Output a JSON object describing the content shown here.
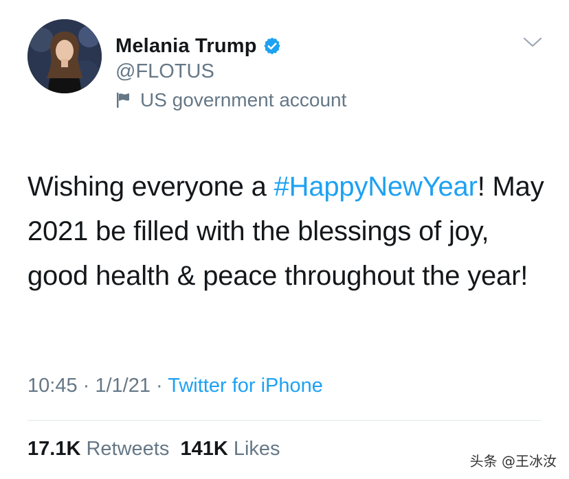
{
  "user": {
    "display_name": "Melania Trump",
    "handle": "@FLOTUS",
    "label": "US government account",
    "verified_icon": "verified-badge-icon",
    "label_icon": "flag-icon"
  },
  "tweet": {
    "text_prefix": "Wishing everyone a ",
    "hashtag": "#HappyNewYear",
    "text_suffix": "! May 2021 be filled with the blessings of joy, good health & peace throughout the year!"
  },
  "meta": {
    "time": "10:45",
    "sep1": " · ",
    "date": "1/1/21",
    "sep2": " · ",
    "source": "Twitter for iPhone"
  },
  "stats": {
    "retweets_count": "17.1K",
    "retweets_label": "Retweets",
    "likes_count": "141K",
    "likes_label": "Likes"
  },
  "watermark": "头条 @王冰汝",
  "colors": {
    "link": "#1da1f2",
    "text": "#14171a",
    "secondary": "#657786"
  }
}
